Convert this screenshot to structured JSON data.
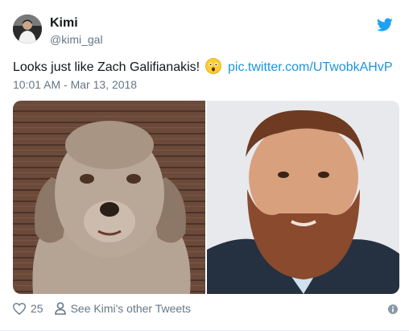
{
  "tweet": {
    "display_name": "Kimi",
    "handle": "@kimi_gal",
    "text_main": "Looks just like Zach Galifianakis!",
    "emoji": "astonished-face-emoji",
    "link": "pic.twitter.com/UTwobkAHvP",
    "timestamp": "10:01 AM - Mar 13, 2018"
  },
  "media": {
    "left_image": "dog-with-human-like-face-photo",
    "right_image": "bearded-man-portrait-photo"
  },
  "actions": {
    "like_count": "25",
    "profile_link": "See Kimi's other Tweets"
  },
  "icons": {
    "brand": "twitter-bird-icon",
    "like": "heart-icon",
    "profile": "person-icon",
    "info": "info-icon"
  },
  "colors": {
    "link": "#1b95e0",
    "brand": "#1da1f2",
    "muted": "#657786",
    "text": "#14171a"
  }
}
